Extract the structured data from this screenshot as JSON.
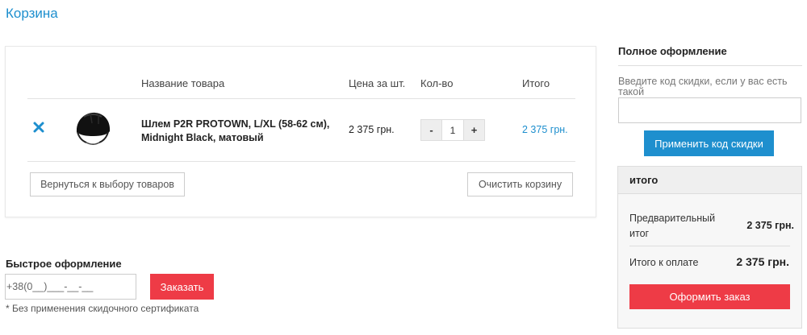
{
  "page": {
    "title": "Корзина"
  },
  "cart": {
    "columns": {
      "name": "Название товара",
      "price": "Цена за шт.",
      "qty": "Кол-во",
      "total": "Итого"
    },
    "items": [
      {
        "name": "Шлем P2R PROTOWN, L/XL (58-62 см), Midnight Black, матовый",
        "price": "2 375 грн.",
        "qty_minus": "-",
        "qty": "1",
        "qty_plus": "+",
        "total": "2 375 грн.",
        "remove_icon": "close-x-icon"
      }
    ],
    "back_button": "Вернуться к выбору товаров",
    "clear_button": "Очистить корзину"
  },
  "quick_order": {
    "title": "Быстрое оформление",
    "phone_value": "+38(0__)___-__-__",
    "order_button": "Заказать",
    "note": "* Без применения скидочного сертификата"
  },
  "full_order": {
    "title": "Полное оформление",
    "discount_label": "Введите код скидки, если у вас есть такой",
    "discount_value": "",
    "apply_button": "Применить код скидки"
  },
  "summary": {
    "title": "итого",
    "subtotal_label": "Предварительный итог",
    "subtotal_value": "2 375 грн.",
    "total_label": "Итого к оплате",
    "total_value": "2 375 грн.",
    "checkout_button": "Оформить заказ"
  },
  "colors": {
    "accent": "#1e8fce",
    "danger": "#ee3b46"
  }
}
